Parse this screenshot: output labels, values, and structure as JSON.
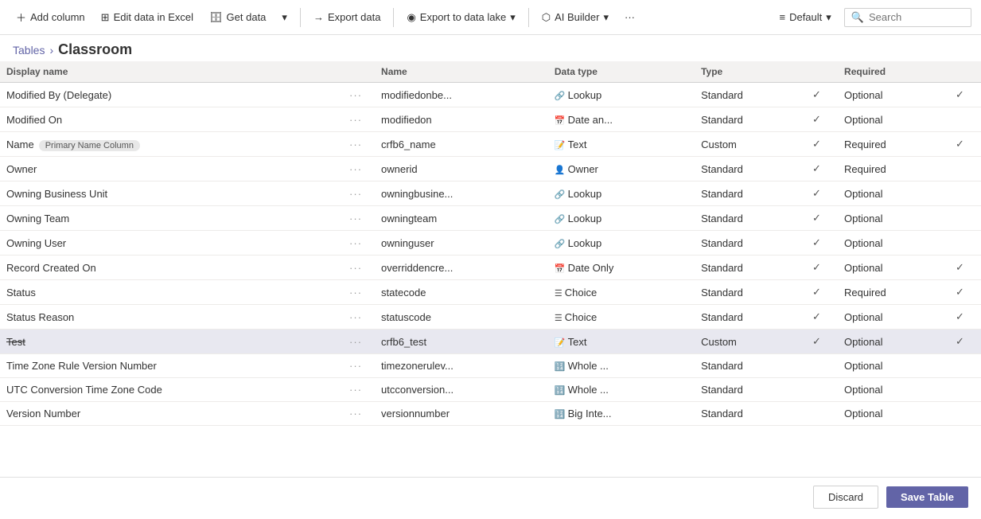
{
  "toolbar": {
    "add_column_label": "Add column",
    "edit_excel_label": "Edit data in Excel",
    "get_data_label": "Get data",
    "export_data_label": "Export data",
    "export_lake_label": "Export to data lake",
    "ai_builder_label": "AI Builder",
    "more_label": "···",
    "default_label": "Default",
    "search_label": "Search",
    "search_placeholder": "Search"
  },
  "breadcrumb": {
    "tables_label": "Tables",
    "separator": "›",
    "current": "Classroom"
  },
  "table": {
    "columns": [
      "Display name",
      "",
      "Name",
      "Data type",
      "Type",
      "",
      "Required",
      ""
    ],
    "rows": [
      {
        "display": "Modified By (Delegate)",
        "name": "modifiedonbe...",
        "type_icon": "🔗",
        "data_type": "Lookup",
        "col_type": "Standard",
        "check1": "✓",
        "required": "Optional",
        "check2": "✓",
        "highlighted": false,
        "strikethrough": false
      },
      {
        "display": "Modified On",
        "name": "modifiedon",
        "type_icon": "📅",
        "data_type": "Date an...",
        "col_type": "Standard",
        "check1": "✓",
        "required": "Optional",
        "check2": "",
        "highlighted": false,
        "strikethrough": false
      },
      {
        "display": "Name",
        "badge": "Primary Name Column",
        "name": "crfb6_name",
        "type_icon": "📝",
        "data_type": "Text",
        "col_type": "Custom",
        "check1": "✓",
        "required": "Required",
        "check2": "✓",
        "highlighted": false,
        "strikethrough": false
      },
      {
        "display": "Owner",
        "name": "ownerid",
        "type_icon": "👤",
        "data_type": "Owner",
        "col_type": "Standard",
        "check1": "✓",
        "required": "Required",
        "check2": "",
        "highlighted": false,
        "strikethrough": false
      },
      {
        "display": "Owning Business Unit",
        "name": "owningbusine...",
        "type_icon": "🔗",
        "data_type": "Lookup",
        "col_type": "Standard",
        "check1": "✓",
        "required": "Optional",
        "check2": "",
        "highlighted": false,
        "strikethrough": false
      },
      {
        "display": "Owning Team",
        "name": "owningteam",
        "type_icon": "🔗",
        "data_type": "Lookup",
        "col_type": "Standard",
        "check1": "✓",
        "required": "Optional",
        "check2": "",
        "highlighted": false,
        "strikethrough": false
      },
      {
        "display": "Owning User",
        "name": "owninguser",
        "type_icon": "🔗",
        "data_type": "Lookup",
        "col_type": "Standard",
        "check1": "✓",
        "required": "Optional",
        "check2": "",
        "highlighted": false,
        "strikethrough": false
      },
      {
        "display": "Record Created On",
        "name": "overriddencre...",
        "type_icon": "📅",
        "data_type": "Date Only",
        "col_type": "Standard",
        "check1": "✓",
        "required": "Optional",
        "check2": "✓",
        "highlighted": false,
        "strikethrough": false
      },
      {
        "display": "Status",
        "name": "statecode",
        "type_icon": "☰",
        "data_type": "Choice",
        "col_type": "Standard",
        "check1": "✓",
        "required": "Required",
        "check2": "✓",
        "highlighted": false,
        "strikethrough": false
      },
      {
        "display": "Status Reason",
        "name": "statuscode",
        "type_icon": "☰",
        "data_type": "Choice",
        "col_type": "Standard",
        "check1": "✓",
        "required": "Optional",
        "check2": "✓",
        "highlighted": false,
        "strikethrough": false
      },
      {
        "display": "Test",
        "name": "crfb6_test",
        "type_icon": "📝",
        "data_type": "Text",
        "col_type": "Custom",
        "check1": "✓",
        "required": "Optional",
        "check2": "✓",
        "highlighted": true,
        "strikethrough": true
      },
      {
        "display": "Time Zone Rule Version Number",
        "name": "timezonerulev...",
        "type_icon": "🔢",
        "data_type": "Whole ...",
        "col_type": "Standard",
        "check1": "",
        "required": "Optional",
        "check2": "",
        "highlighted": false,
        "strikethrough": false
      },
      {
        "display": "UTC Conversion Time Zone Code",
        "name": "utcconversion...",
        "type_icon": "🔢",
        "data_type": "Whole ...",
        "col_type": "Standard",
        "check1": "",
        "required": "Optional",
        "check2": "",
        "highlighted": false,
        "strikethrough": false
      },
      {
        "display": "Version Number",
        "name": "versionnumber",
        "type_icon": "🔢",
        "data_type": "Big Inte...",
        "col_type": "Standard",
        "check1": "",
        "required": "Optional",
        "check2": "",
        "highlighted": false,
        "strikethrough": false
      }
    ]
  },
  "footer": {
    "discard_label": "Discard",
    "save_label": "Save Table"
  }
}
